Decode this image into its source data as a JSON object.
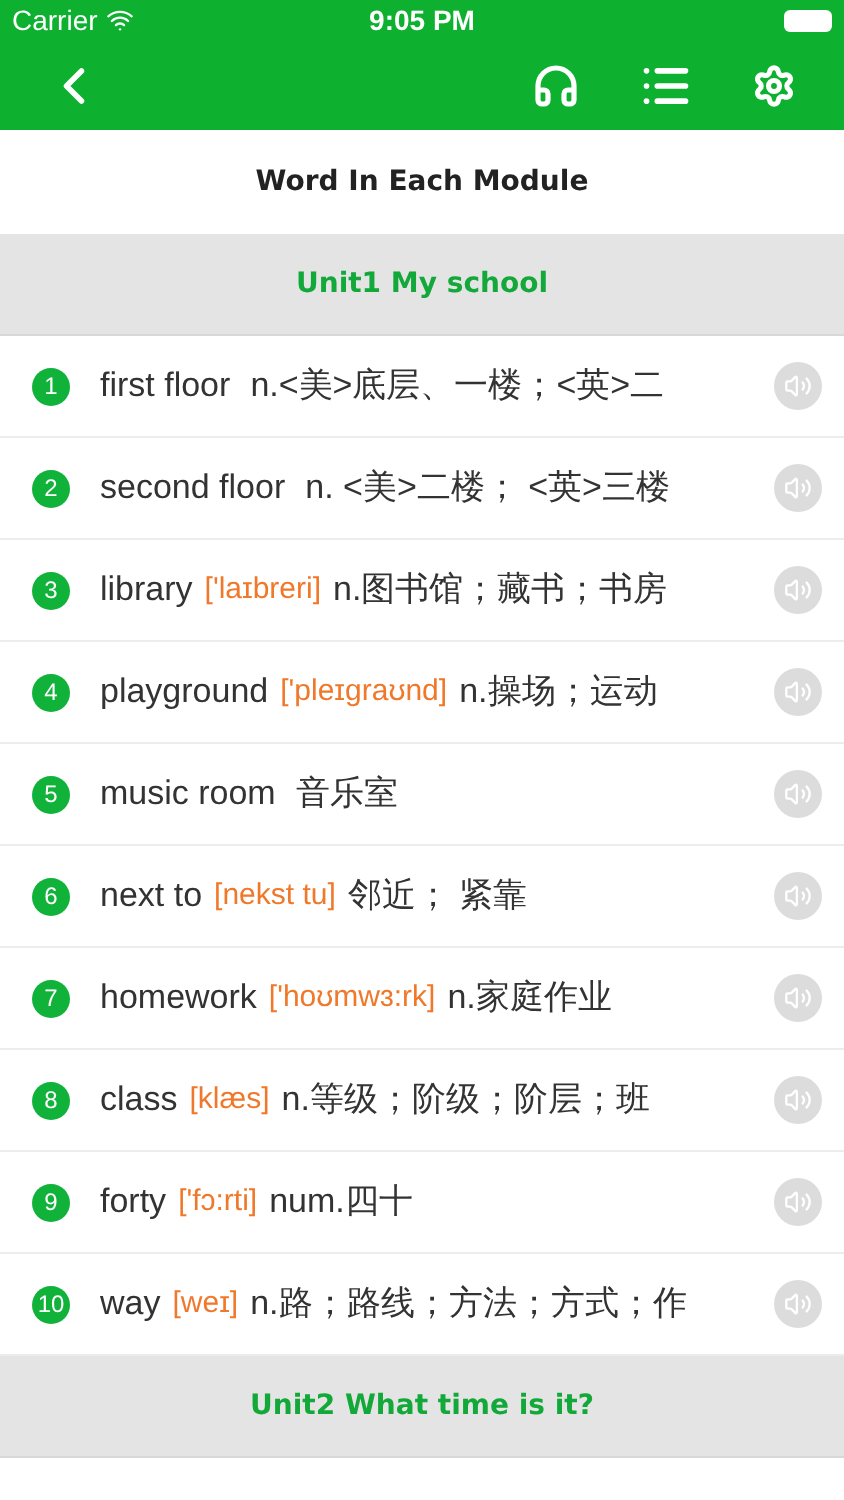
{
  "status_bar": {
    "carrier": "Carrier",
    "time": "9:05 PM"
  },
  "title": "Word In Each Module",
  "units": [
    {
      "title": "Unit1 My school",
      "words": [
        {
          "number": "1",
          "word": "first floor",
          "meaning": "n.<美>底层、一楼；<英>二"
        },
        {
          "number": "2",
          "word": "second floor",
          "meaning": "n. <美>二楼； <英>三楼"
        },
        {
          "number": "3",
          "word": "library",
          "phonetic": "['laɪbreri]",
          "meaning": "n.图书馆；藏书；书房"
        },
        {
          "number": "4",
          "word": "playground",
          "phonetic": "['pleɪgraʊnd]",
          "meaning": "n.操场；运动"
        },
        {
          "number": "5",
          "word": "music room",
          "meaning": "音乐室"
        },
        {
          "number": "6",
          "word": "next to",
          "phonetic": "[nekst tu]",
          "meaning": "邻近； 紧靠"
        },
        {
          "number": "7",
          "word": "homework",
          "phonetic": "['hoʊmwɜ:rk]",
          "meaning": "n.家庭作业"
        },
        {
          "number": "8",
          "word": "class",
          "phonetic": "[klæs]",
          "meaning": "n.等级；阶级；阶层；班"
        },
        {
          "number": "9",
          "word": "forty",
          "phonetic": "['fɔ:rti]",
          "meaning": "num.四十"
        },
        {
          "number": "10",
          "word": "way",
          "phonetic": "[weɪ]",
          "meaning": "n.路；路线；方法；方式；作"
        }
      ]
    },
    {
      "title": "Unit2 What time is it?"
    }
  ]
}
